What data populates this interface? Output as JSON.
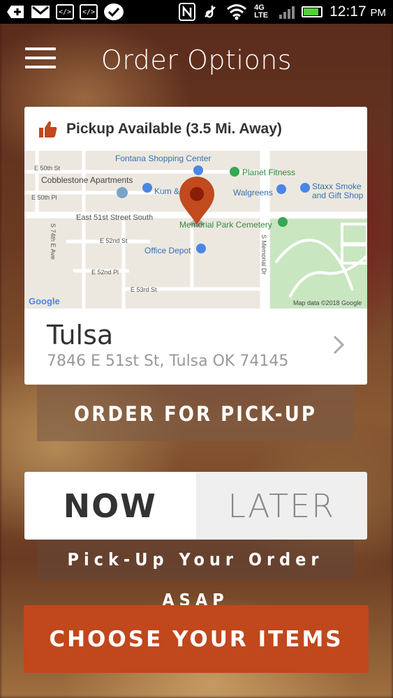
{
  "status_bar": {
    "icons": [
      "add-icon",
      "gmail-icon",
      "code-icon",
      "code-icon",
      "check-icon",
      "nfc-icon",
      "mute-icon",
      "wifi-icon"
    ],
    "network": "4G LTE",
    "time": "12:17",
    "ampm": "PM"
  },
  "header": {
    "title": "Order Options"
  },
  "location_card": {
    "availability": "Pickup Available (3.5 Mi. Away)",
    "map": {
      "labels": {
        "fontana": "Fontana Shopping Center",
        "cobblestone": "Cobblestone Apartments",
        "planet": "Planet Fitness",
        "kum": "Kum &",
        "walgreens": "Walgreens",
        "staxx1": "Staxx Smoke",
        "staxx2": "and Gift Shop",
        "e50st": "E 50th St",
        "e50pl": "E 50th Pl",
        "e51": "East 51st Street South",
        "memorial_park": "Memorial Park Cemetery",
        "e52st": "E 52nd St",
        "e74": "S 74th E Ave",
        "office_depot": "Office Depot",
        "e52pl": "E 52nd Pl",
        "smemorial": "S Memorial Dr",
        "e53": "E 53rd St",
        "google": "Google",
        "attribution": "Map data ©2018 Google"
      }
    },
    "city": "Tulsa",
    "address": "7846 E 51st St, Tulsa OK 74145"
  },
  "order_type_label": "ORDER FOR PICK-UP",
  "timing": {
    "now": "NOW",
    "later": "LATER",
    "selected": "now"
  },
  "asap_label": "Pick-Up Your Order ASAP",
  "cta_label": "CHOOSE YOUR ITEMS",
  "colors": {
    "accent": "#c1471c",
    "pin": "#c14a1e",
    "map_green": "#34a853"
  }
}
